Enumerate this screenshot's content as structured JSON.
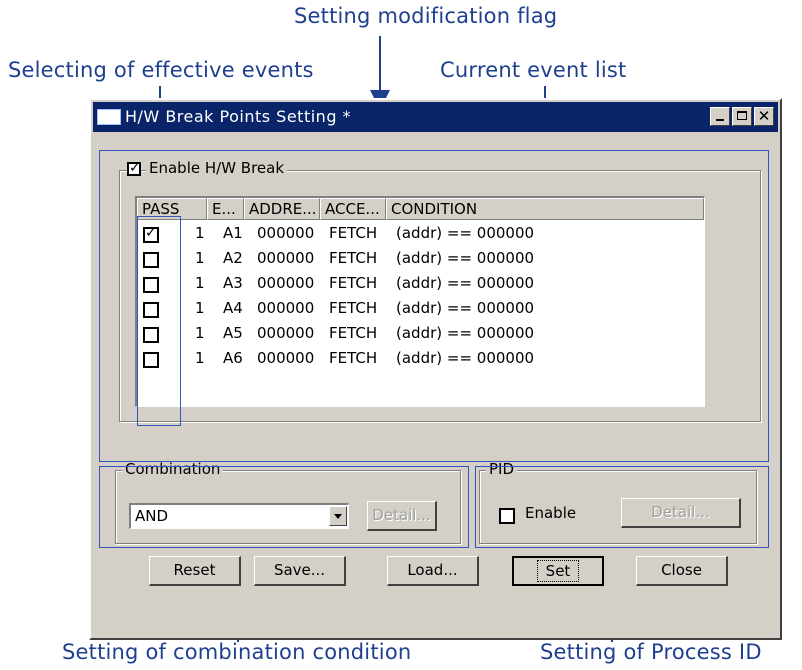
{
  "callouts": {
    "modification_flag": "Setting modification flag",
    "effective_events": "Selecting of effective events",
    "current_event_list": "Current event list",
    "combination_condition": "Setting of combination condition",
    "process_id": "Setting of Process ID"
  },
  "window": {
    "title": "H/W Break Points Setting *",
    "close_glyph": "✕"
  },
  "enable_group": {
    "label": "Enable H/W Break",
    "checked": true
  },
  "event_list": {
    "columns": [
      "PASS",
      "E...",
      "ADDRE...",
      "ACCE...",
      "CONDITION"
    ],
    "rows": [
      {
        "checked": true,
        "pass": "1",
        "event": "A1",
        "address": "000000",
        "access": "FETCH",
        "condition": "(addr) == 000000"
      },
      {
        "checked": false,
        "pass": "1",
        "event": "A2",
        "address": "000000",
        "access": "FETCH",
        "condition": "(addr) == 000000"
      },
      {
        "checked": false,
        "pass": "1",
        "event": "A3",
        "address": "000000",
        "access": "FETCH",
        "condition": "(addr) == 000000"
      },
      {
        "checked": false,
        "pass": "1",
        "event": "A4",
        "address": "000000",
        "access": "FETCH",
        "condition": "(addr) == 000000"
      },
      {
        "checked": false,
        "pass": "1",
        "event": "A5",
        "address": "000000",
        "access": "FETCH",
        "condition": "(addr) == 000000"
      },
      {
        "checked": false,
        "pass": "1",
        "event": "A6",
        "address": "000000",
        "access": "FETCH",
        "condition": "(addr) == 000000"
      }
    ]
  },
  "combination": {
    "label": "Combination",
    "value": "AND",
    "detail_label": "Detail..."
  },
  "pid": {
    "label": "PID",
    "enable_label": "Enable",
    "enabled": false,
    "detail_label": "Detail..."
  },
  "buttons": {
    "reset": "Reset",
    "save": "Save...",
    "load": "Load...",
    "set": "Set",
    "close": "Close"
  },
  "colors": {
    "annotation": "#1f3f8f",
    "titlebar": "#0a246a",
    "dialog_face": "#d4d0c8"
  }
}
